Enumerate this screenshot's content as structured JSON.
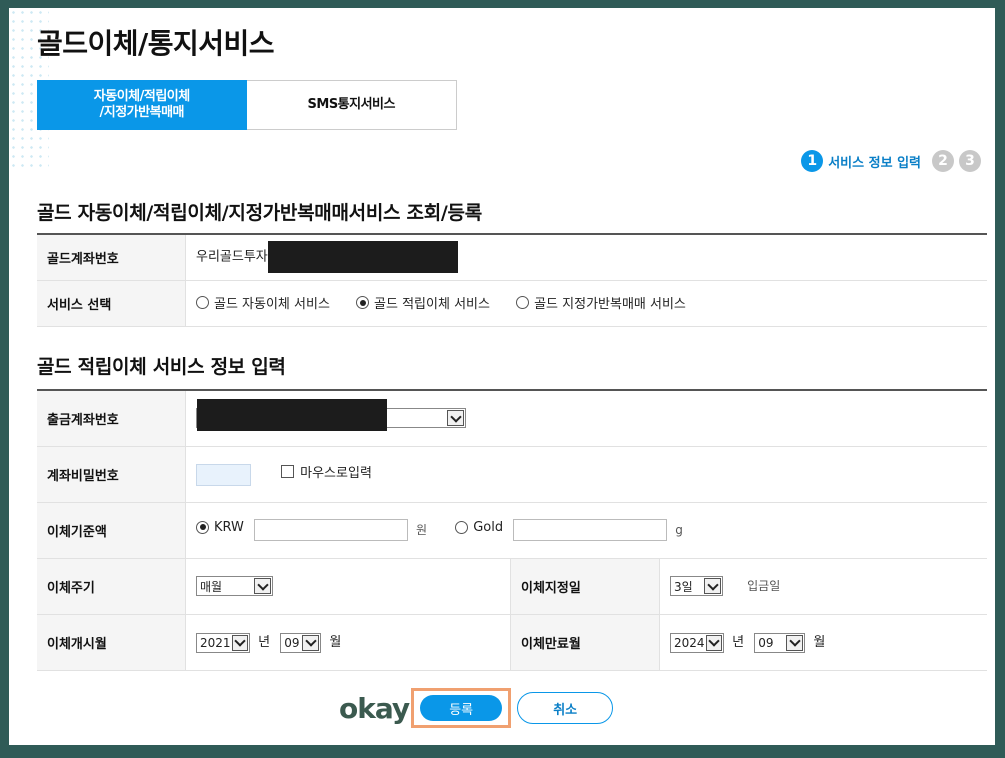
{
  "page": {
    "title": "골드이체/통지서비스"
  },
  "tabs": [
    {
      "label_line1": "자동이체/적립이체",
      "label_line2": "/지정가반복매매"
    },
    {
      "label": "SMS통지서비스"
    }
  ],
  "steps": {
    "step1_num": "1",
    "step1_label": "서비스 정보 입력",
    "step2_num": "2",
    "step3_num": "3"
  },
  "section1": {
    "title": "골드 자동이체/적립이체/지정가반복매매서비스 조회/등록",
    "account_label": "골드계좌번호",
    "account_value": "우리골드투자",
    "service_label": "서비스 선택",
    "options": [
      "골드 자동이체 서비스",
      "골드 적립이체 서비스",
      "골드 지정가반복매매 서비스"
    ]
  },
  "section2": {
    "title": "골드 적립이체 서비스 정보 입력",
    "withdraw_label": "출금계좌번호",
    "password_label": "계좌비밀번호",
    "mouse_input_label": "마우스로입력",
    "amount_label": "이체기준액",
    "krw_label": "KRW",
    "krw_unit": "원",
    "gold_label": "Gold",
    "gold_unit": "g",
    "cycle_label": "이체주기",
    "cycle_value": "매월",
    "designated_day_label": "이체지정일",
    "designated_day_value": "3일",
    "deposit_day_text": "입금일",
    "start_label": "이체개시월",
    "start_year": "2021",
    "year_unit": "년",
    "start_month": "09",
    "month_unit": "월",
    "end_label": "이체만료월",
    "end_year": "2024",
    "end_month": "09"
  },
  "footer": {
    "logo": "okay",
    "confirm": "등록",
    "cancel": "취소"
  },
  "colors": {
    "accent": "#0a97e8",
    "frame": "#2f5b57",
    "highlight": "#f0a070"
  }
}
